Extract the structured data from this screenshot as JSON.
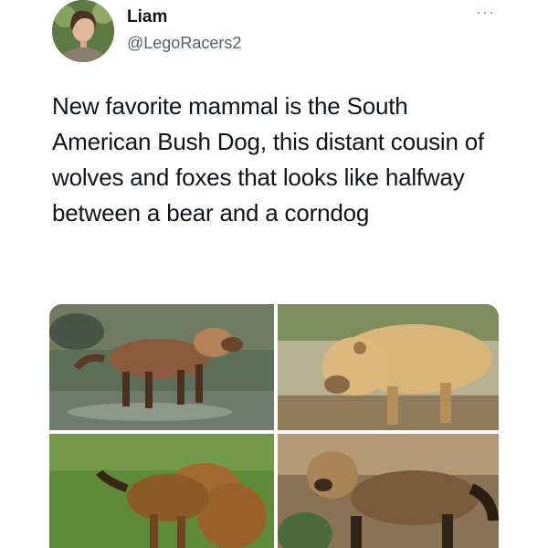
{
  "user": {
    "display_name": "Liam",
    "handle": "@LegoRacers2",
    "avatar_icon": "profile-photo"
  },
  "menu": {
    "more_label": "···",
    "more_icon": "more-options-icon"
  },
  "tweet": {
    "text": "New favorite mammal is the South American Bush Dog, this distant cousin of wolves and foxes that looks like halfway between a bear and a corndog"
  },
  "media": {
    "photos": [
      {
        "subject": "bush dog standing in shallow water"
      },
      {
        "subject": "bush dog close-up on leaf litter"
      },
      {
        "subject": "bush dog on grass"
      },
      {
        "subject": "bush dog among leaves"
      }
    ]
  },
  "colors": {
    "text": "#0f1419",
    "secondary": "#536471",
    "background": "#ffffff"
  }
}
